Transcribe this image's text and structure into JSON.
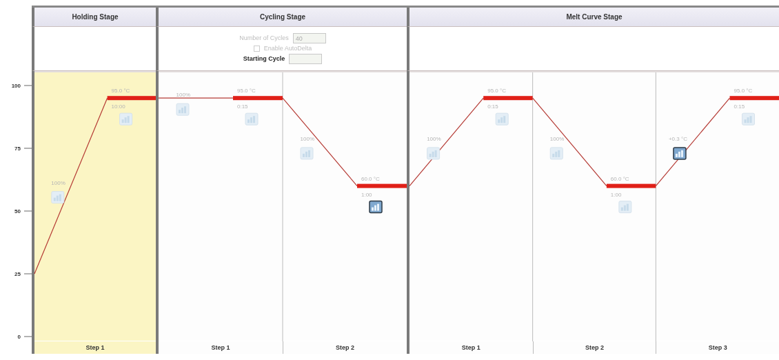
{
  "axis": {
    "ticks": [
      "100",
      "75",
      "50",
      "25",
      "0"
    ]
  },
  "stages": [
    {
      "title": "Holding Stage",
      "steps": [
        {
          "label": "Step 1",
          "selected": true,
          "kind": "high",
          "temperature": "95.0 °C",
          "time": "10:00",
          "ramp_rate": "100%",
          "ramp_collect": false,
          "hold_collect": false
        }
      ]
    },
    {
      "title": "Cycling Stage",
      "settings": [
        {
          "kind": "number",
          "label": "Number of Cycles",
          "value": "40",
          "disabled": true
        },
        {
          "kind": "checkbox",
          "label": "Enable AutoDelta",
          "checked": false,
          "disabled": true
        },
        {
          "kind": "number",
          "label": "Starting Cycle",
          "disabled": false
        }
      ],
      "steps": [
        {
          "label": "Step 1",
          "selected": false,
          "kind": "high",
          "temperature": "95.0 °C",
          "time": "0:15",
          "ramp_rate": "100%",
          "ramp_collect": false,
          "hold_collect": false
        },
        {
          "label": "Step 2",
          "selected": false,
          "kind": "low",
          "temperature": "60.0 °C",
          "time": "1:00",
          "ramp_rate": "100%",
          "ramp_collect": false,
          "hold_collect": true
        }
      ]
    },
    {
      "title": "Melt Curve Stage",
      "steps": [
        {
          "label": "Step 1",
          "selected": false,
          "kind": "high",
          "temperature": "95.0 °C",
          "time": "0:15",
          "ramp_rate": "100%",
          "ramp_collect": false,
          "hold_collect": false
        },
        {
          "label": "Step 2",
          "selected": false,
          "kind": "low",
          "temperature": "60.0 °C",
          "time": "1:00",
          "ramp_rate": "100%",
          "ramp_collect": false,
          "hold_collect": false
        },
        {
          "label": "Step 3",
          "selected": false,
          "kind": "high",
          "temperature": "95.0 °C",
          "time": "0:15",
          "ramp_rate": "+0.3 °C",
          "ramp_collect": true,
          "hold_collect": false
        }
      ]
    }
  ]
}
